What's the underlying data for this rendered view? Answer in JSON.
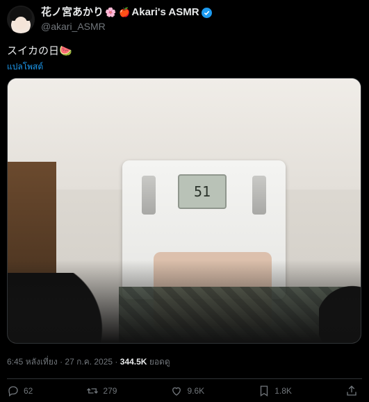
{
  "author": {
    "display_name": "花ノ宮あかり",
    "decor1": "🌸",
    "decor2": "🍎",
    "display_name_suffix": "Akari's ASMR",
    "handle": "@akari_ASMR",
    "verified_color": "#1d9bf0"
  },
  "tweet": {
    "text": "スイカの日🍉",
    "translate_label": "แปลโพสต์"
  },
  "media": {
    "scale_display": "51"
  },
  "meta": {
    "time": "6:45 หลังเที่ยง",
    "date": "27 ก.ค. 2025",
    "views": "344.5K",
    "views_label": "ยอดดู"
  },
  "actions": {
    "replies": "62",
    "reposts": "279",
    "likes": "9.6K",
    "bookmarks": "1.8K"
  },
  "colors": {
    "background": "#000000",
    "text": "#e7e9ea",
    "muted": "#71767b",
    "accent": "#1d9bf0",
    "divider": "#2f3336"
  }
}
